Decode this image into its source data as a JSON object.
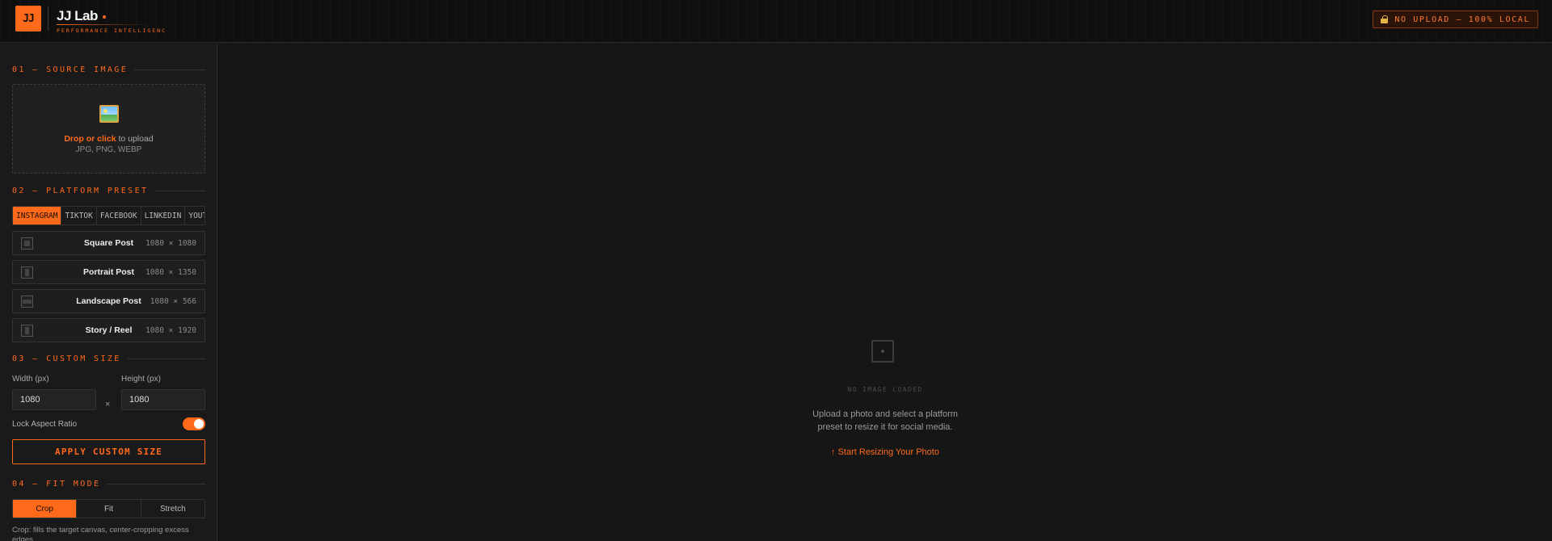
{
  "brand": {
    "logo_text": "JJ",
    "title": "JJ Lab",
    "subtitle": "PERFORMANCE INTELLIGENC"
  },
  "header": {
    "badge": "NO UPLOAD — 100% LOCAL",
    "badge_icon": "lock-icon"
  },
  "colors": {
    "accent": "#ff6a1a",
    "background": "#171717",
    "sidebar": "#1a1a1a"
  },
  "sections": {
    "source": "01 — SOURCE IMAGE",
    "platform": "02 — PLATFORM PRESET",
    "custom": "03 — CUSTOM SIZE",
    "fit": "04 — FIT MODE"
  },
  "dropzone": {
    "icon": "image-icon",
    "highlight": "Drop or click",
    "rest": " to upload",
    "formats": "JPG, PNG, WEBP"
  },
  "platform_tabs": [
    {
      "label": "INSTAGRAM",
      "active": true
    },
    {
      "label": "TIKTOK",
      "active": false
    },
    {
      "label": "FACEBOOK",
      "active": false
    },
    {
      "label": "LINKEDIN",
      "active": false
    },
    {
      "label": "YOUTU",
      "active": false
    }
  ],
  "presets": [
    {
      "name": "Square Post",
      "dims": "1080 × 1080"
    },
    {
      "name": "Portrait Post",
      "dims": "1080 × 1350"
    },
    {
      "name": "Landscape Post",
      "dims": "1080 × 566"
    },
    {
      "name": "Story / Reel",
      "dims": "1080 × 1920"
    }
  ],
  "custom_size": {
    "width_label": "Width (px)",
    "height_label": "Height (px)",
    "width_value": "1080",
    "height_value": "1080",
    "times": "×",
    "lock_label": "Lock Aspect Ratio",
    "lock_on": true,
    "apply_label": "APPLY CUSTOM SIZE"
  },
  "fit_mode": {
    "options": [
      {
        "label": "Crop",
        "active": true
      },
      {
        "label": "Fit",
        "active": false
      },
      {
        "label": "Stretch",
        "active": false
      }
    ],
    "help": "Crop: fills the target canvas, center-cropping excess edges."
  },
  "empty_state": {
    "icon": "empty-image-icon",
    "title": "NO IMAGE LOADED",
    "description": "Upload a photo and select a platform preset to resize it for social media.",
    "cta": "↑ Start Resizing Your Photo"
  }
}
